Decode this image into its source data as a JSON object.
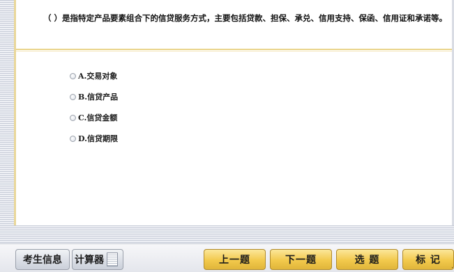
{
  "question": {
    "text": "（ ）是指特定产品要素组合下的信贷服务方式，主要包括贷款、担保、承兑、信用支持、保函、信用证和承诺等。"
  },
  "options": [
    {
      "label": "A.交易对象"
    },
    {
      "label": "B.信贷产品"
    },
    {
      "label": "C.信贷金额"
    },
    {
      "label": "D.信贷期限"
    }
  ],
  "toolbar": {
    "candidate_info": "考生信息",
    "calculator": "计算器",
    "prev": "上一题",
    "next": "下一题",
    "select": "选 题",
    "mark": "标 记"
  },
  "colors": {
    "gold_button": "#f2c94c",
    "grey_button": "#d9dde5",
    "divider": "#ead48a"
  }
}
